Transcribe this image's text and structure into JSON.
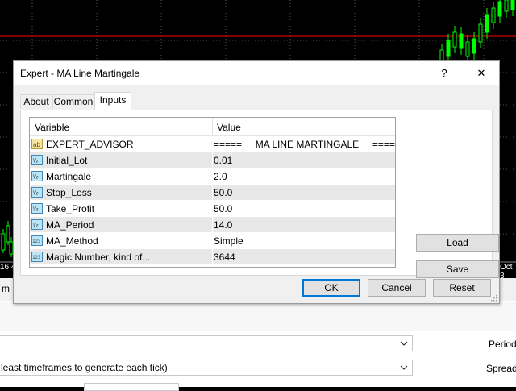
{
  "dialog": {
    "title": "Expert - MA Line Martingale",
    "help_glyph": "?",
    "close_glyph": "✕",
    "tabs": [
      {
        "label": "About",
        "active": false
      },
      {
        "label": "Common",
        "active": false
      },
      {
        "label": "Inputs",
        "active": true
      }
    ],
    "grid": {
      "col_variable": "Variable",
      "col_value": "Value",
      "rows": [
        {
          "icon": "ab-string-icon",
          "name": "EXPERT_ADVISOR",
          "value": "=====     MA LINE MARTINGALE     ====="
        },
        {
          "icon": "double-value-icon",
          "name": "Initial_Lot",
          "value": "0.01"
        },
        {
          "icon": "double-value-icon",
          "name": "Martingale",
          "value": "2.0"
        },
        {
          "icon": "double-value-icon",
          "name": "Stop_Loss",
          "value": "50.0"
        },
        {
          "icon": "double-value-icon",
          "name": "Take_Profit",
          "value": "50.0"
        },
        {
          "icon": "double-value-icon",
          "name": "MA_Period",
          "value": "14.0"
        },
        {
          "icon": "integer-icon",
          "name": "MA_Method",
          "value": "Simple"
        },
        {
          "icon": "integer-icon",
          "name": "Magic Number, kind of...",
          "value": "3644"
        }
      ]
    },
    "buttons": {
      "load": "Load",
      "save": "Save",
      "ok": "OK",
      "cancel": "Cancel",
      "reset": "Reset"
    }
  },
  "chart": {
    "time_left": "16:4",
    "time_right": "Oct 3",
    "candle_color": "#00ff00",
    "line_color": "#ff0000"
  },
  "tester": {
    "tab_fragment": "m",
    "combo2_text": "least timeframes to generate each tick)",
    "period_label": "Period:",
    "spread_label": "Spread:"
  }
}
